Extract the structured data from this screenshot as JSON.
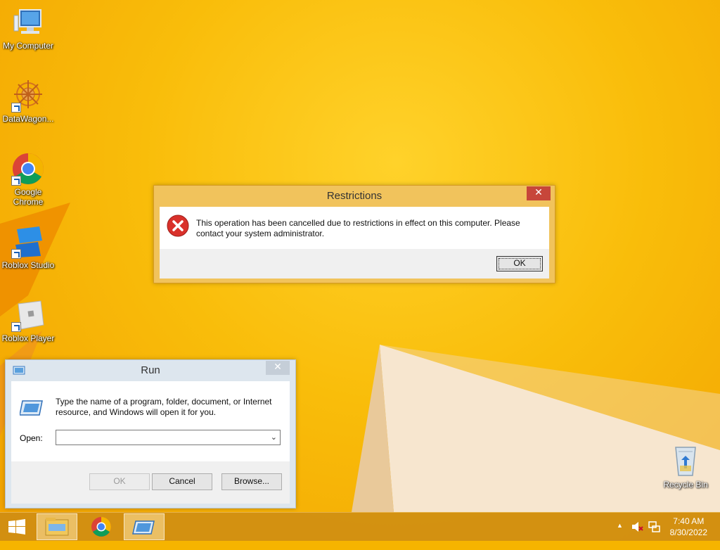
{
  "desktop": {
    "icons": [
      {
        "label": "My Computer"
      },
      {
        "label": "DataWagon..."
      },
      {
        "label": "Google Chrome"
      },
      {
        "label": "Roblox Studio"
      },
      {
        "label": "Roblox Player"
      },
      {
        "label": "Recycle Bin"
      }
    ]
  },
  "restrictions_dialog": {
    "title": "Restrictions",
    "close": "✕",
    "message": "This operation has been cancelled due to restrictions in effect on this computer. Please contact your system administrator.",
    "ok_label": "OK"
  },
  "run_dialog": {
    "title": "Run",
    "close": "✕",
    "message": "Type the name of a program, folder, document, or Internet resource, and Windows will open it for you.",
    "open_label": "Open:",
    "open_value": "",
    "ok_label": "OK",
    "cancel_label": "Cancel",
    "browse_label": "Browse..."
  },
  "taskbar": {
    "time": "7:40 AM",
    "date": "8/30/2022",
    "tray_arrow": "▲"
  },
  "colors": {
    "wallpaper": "#f6b400",
    "restrict_frame": "#f1c35c",
    "close_red": "#c7463a",
    "error_red": "#d9312b"
  }
}
